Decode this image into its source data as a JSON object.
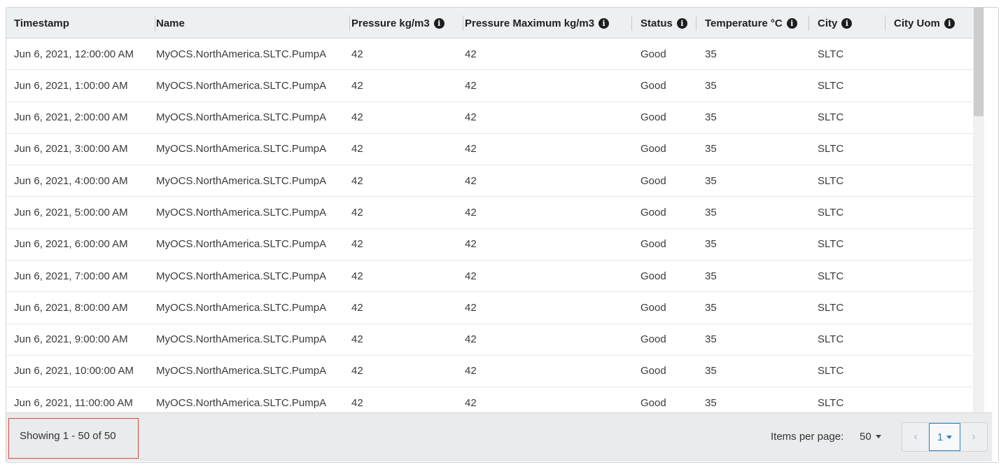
{
  "columns": [
    {
      "label": "Timestamp",
      "info": false
    },
    {
      "label": "Name",
      "info": false
    },
    {
      "label": "Pressure kg/m3",
      "info": true
    },
    {
      "label": "Pressure Maximum kg/m3",
      "info": true
    },
    {
      "label": "Status",
      "info": true
    },
    {
      "label": "Temperature °C",
      "info": true
    },
    {
      "label": "City",
      "info": true
    },
    {
      "label": "City Uom",
      "info": true
    }
  ],
  "rows": [
    [
      "Jun 6, 2021, 12:00:00 AM",
      "MyOCS.NorthAmerica.SLTC.PumpA",
      "42",
      "42",
      "Good",
      "35",
      "SLTC",
      ""
    ],
    [
      "Jun 6, 2021, 1:00:00 AM",
      "MyOCS.NorthAmerica.SLTC.PumpA",
      "42",
      "42",
      "Good",
      "35",
      "SLTC",
      ""
    ],
    [
      "Jun 6, 2021, 2:00:00 AM",
      "MyOCS.NorthAmerica.SLTC.PumpA",
      "42",
      "42",
      "Good",
      "35",
      "SLTC",
      ""
    ],
    [
      "Jun 6, 2021, 3:00:00 AM",
      "MyOCS.NorthAmerica.SLTC.PumpA",
      "42",
      "42",
      "Good",
      "35",
      "SLTC",
      ""
    ],
    [
      "Jun 6, 2021, 4:00:00 AM",
      "MyOCS.NorthAmerica.SLTC.PumpA",
      "42",
      "42",
      "Good",
      "35",
      "SLTC",
      ""
    ],
    [
      "Jun 6, 2021, 5:00:00 AM",
      "MyOCS.NorthAmerica.SLTC.PumpA",
      "42",
      "42",
      "Good",
      "35",
      "SLTC",
      ""
    ],
    [
      "Jun 6, 2021, 6:00:00 AM",
      "MyOCS.NorthAmerica.SLTC.PumpA",
      "42",
      "42",
      "Good",
      "35",
      "SLTC",
      ""
    ],
    [
      "Jun 6, 2021, 7:00:00 AM",
      "MyOCS.NorthAmerica.SLTC.PumpA",
      "42",
      "42",
      "Good",
      "35",
      "SLTC",
      ""
    ],
    [
      "Jun 6, 2021, 8:00:00 AM",
      "MyOCS.NorthAmerica.SLTC.PumpA",
      "42",
      "42",
      "Good",
      "35",
      "SLTC",
      ""
    ],
    [
      "Jun 6, 2021, 9:00:00 AM",
      "MyOCS.NorthAmerica.SLTC.PumpA",
      "42",
      "42",
      "Good",
      "35",
      "SLTC",
      ""
    ],
    [
      "Jun 6, 2021, 10:00:00 AM",
      "MyOCS.NorthAmerica.SLTC.PumpA",
      "42",
      "42",
      "Good",
      "35",
      "SLTC",
      ""
    ],
    [
      "Jun 6, 2021, 11:00:00 AM",
      "MyOCS.NorthAmerica.SLTC.PumpA",
      "42",
      "42",
      "Good",
      "35",
      "SLTC",
      ""
    ]
  ],
  "footer": {
    "showing": "Showing 1 - 50 of 50",
    "items_per_page_label": "Items per page:",
    "items_per_page_value": "50",
    "current_page": "1",
    "prev_glyph": "‹",
    "next_glyph": "›"
  },
  "icons": {
    "info": "info-icon",
    "dropdown": "caret-down-icon",
    "prev": "chevron-left-icon",
    "next": "chevron-right-icon"
  },
  "colors": {
    "header_bg": "#edf0f1",
    "footer_bg": "#e9ebec",
    "accent": "#2f7fb9",
    "highlight": "#e0463c"
  }
}
